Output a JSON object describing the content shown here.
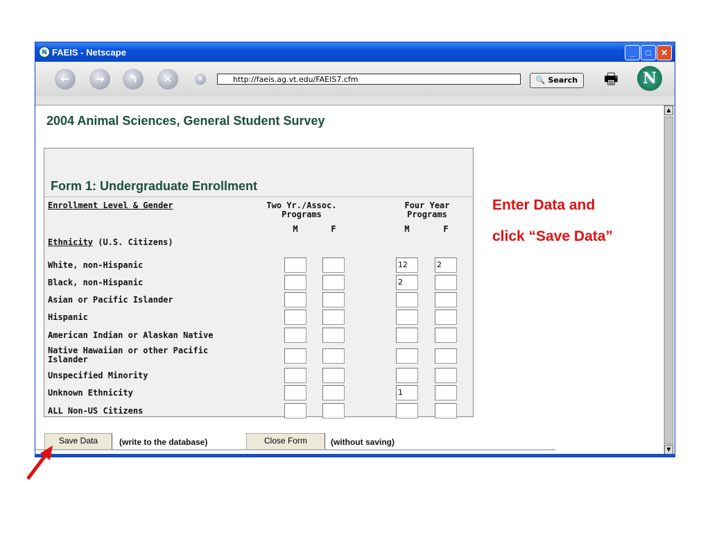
{
  "window": {
    "title": "FAEIS - Netscape",
    "url": "http://faeis.ag.vt.edu/FAEIS7.cfm",
    "search_label": "Search"
  },
  "page": {
    "title": "2004 Animal Sciences, General Student Survey"
  },
  "form": {
    "title": "Form 1: Undergraduate Enrollment",
    "col_label": "Enrollment Level & Gender",
    "group1": [
      "Two Yr./Assoc.",
      "Programs"
    ],
    "group2": [
      "Four Year",
      "Programs"
    ],
    "m": "M",
    "f": "F",
    "ethnicity_label": "Ethnicity",
    "ethnicity_suffix": " (U.S. Citizens)",
    "rows": [
      {
        "label": "White, non-Hispanic",
        "values": [
          "",
          "",
          "12",
          "2"
        ]
      },
      {
        "label": "Black, non-Hispanic",
        "values": [
          "",
          "",
          "2",
          ""
        ]
      },
      {
        "label": "Asian or Pacific Islander",
        "values": [
          "",
          "",
          "",
          ""
        ]
      },
      {
        "label": "Hispanic",
        "values": [
          "",
          "",
          "",
          ""
        ]
      },
      {
        "label": "American Indian or Alaskan Native",
        "values": [
          "",
          "",
          "",
          ""
        ]
      },
      {
        "label": "Native Hawaiian or other Pacific Islander",
        "values": [
          "",
          "",
          "",
          ""
        ]
      },
      {
        "label": "Unspecified Minority",
        "values": [
          "",
          "",
          "",
          ""
        ]
      },
      {
        "label": "Unknown Ethnicity",
        "values": [
          "",
          "",
          "1",
          ""
        ]
      },
      {
        "label": "ALL Non-US Citizens",
        "values": [
          "",
          "",
          "",
          ""
        ]
      }
    ]
  },
  "buttons": {
    "save": "Save Data",
    "save_note": "(write to the database)",
    "close": "Close Form",
    "close_note": "(without saving)"
  },
  "annotation": {
    "line1": "Enter Data and",
    "line2": "click “Save Data”"
  }
}
